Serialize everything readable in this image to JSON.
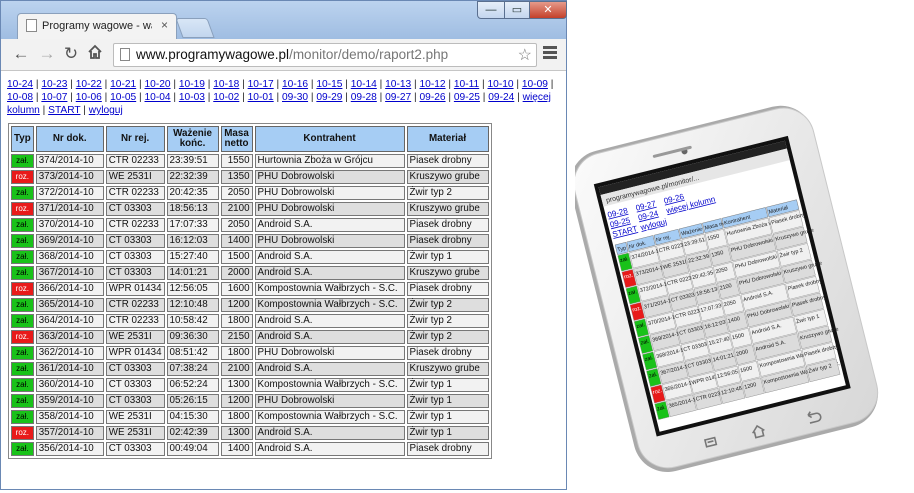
{
  "browser": {
    "tab_title": "Programy wagowe - waże",
    "tab_close": "×",
    "url_host": "www.programywagowe.pl",
    "url_path": "/monitor/demo/raport2.php",
    "buttons": {
      "minimize": "—",
      "maximize": "▭",
      "close": "✕"
    }
  },
  "nav": {
    "date_links": [
      "10-24",
      "10-23",
      "10-22",
      "10-21",
      "10-20",
      "10-19",
      "10-18",
      "10-17",
      "10-16",
      "10-15",
      "10-14",
      "10-13",
      "10-12",
      "10-11",
      "10-10",
      "10-09",
      "10-08",
      "10-07",
      "10-06",
      "10-05",
      "10-04",
      "10-03",
      "10-02",
      "10-01",
      "09-30",
      "09-29",
      "09-28",
      "09-27",
      "09-26",
      "09-25",
      "09-24"
    ],
    "more_columns": "więcej kolumn",
    "start": "START",
    "logout": "wyloguj"
  },
  "table": {
    "headers": [
      "Typ",
      "Nr dok.",
      "Nr rej.",
      "Ważenie końc.",
      "Masa netto",
      "Kontrahent",
      "Materiał"
    ],
    "rows": [
      {
        "type": "zał.",
        "doc": "374/2014-10",
        "reg": "CTR 02233",
        "time": "23:39:51",
        "mass": "1550",
        "contractor": "Hurtownia Zboża w Grójcu",
        "material": "Piasek drobny"
      },
      {
        "type": "roz.",
        "doc": "373/2014-10",
        "reg": "WE 2531I",
        "time": "22:32:39",
        "mass": "1350",
        "contractor": "PHU Dobrowolski",
        "material": "Kruszywo grube"
      },
      {
        "type": "zał.",
        "doc": "372/2014-10",
        "reg": "CTR 02233",
        "time": "20:42:35",
        "mass": "2050",
        "contractor": "PHU Dobrowolski",
        "material": "Żwir typ 2"
      },
      {
        "type": "roz.",
        "doc": "371/2014-10",
        "reg": "CT 03303",
        "time": "18:56:13",
        "mass": "2100",
        "contractor": "PHU Dobrowolski",
        "material": "Kruszywo grube"
      },
      {
        "type": "zał.",
        "doc": "370/2014-10",
        "reg": "CTR 02233",
        "time": "17:07:33",
        "mass": "2050",
        "contractor": "Android S.A.",
        "material": "Piasek drobny"
      },
      {
        "type": "zał.",
        "doc": "369/2014-10",
        "reg": "CT 03303",
        "time": "16:12:03",
        "mass": "1400",
        "contractor": "PHU Dobrowolski",
        "material": "Piasek drobny"
      },
      {
        "type": "zał.",
        "doc": "368/2014-10",
        "reg": "CT 03303",
        "time": "15:27:40",
        "mass": "1500",
        "contractor": "Android S.A.",
        "material": "Żwir typ 1"
      },
      {
        "type": "zał.",
        "doc": "367/2014-10",
        "reg": "CT 03303",
        "time": "14:01:21",
        "mass": "2000",
        "contractor": "Android S.A.",
        "material": "Kruszywo grube"
      },
      {
        "type": "roz.",
        "doc": "366/2014-10",
        "reg": "WPR 01434",
        "time": "12:56:05",
        "mass": "1600",
        "contractor": "Kompostownia Wałbrzych - S.C.",
        "material": "Piasek drobny"
      },
      {
        "type": "zał.",
        "doc": "365/2014-10",
        "reg": "CTR 02233",
        "time": "12:10:48",
        "mass": "1200",
        "contractor": "Kompostownia Wałbrzych - S.C.",
        "material": "Żwir typ 2"
      },
      {
        "type": "zał.",
        "doc": "364/2014-10",
        "reg": "CTR 02233",
        "time": "10:58:42",
        "mass": "1800",
        "contractor": "Android S.A.",
        "material": "Żwir typ 2"
      },
      {
        "type": "roz.",
        "doc": "363/2014-10",
        "reg": "WE 2531I",
        "time": "09:36:30",
        "mass": "2150",
        "contractor": "Android S.A.",
        "material": "Żwir typ 2"
      },
      {
        "type": "zał.",
        "doc": "362/2014-10",
        "reg": "WPR 01434",
        "time": "08:51:42",
        "mass": "1800",
        "contractor": "PHU Dobrowolski",
        "material": "Piasek drobny"
      },
      {
        "type": "zał.",
        "doc": "361/2014-10",
        "reg": "CT 03303",
        "time": "07:38:24",
        "mass": "2100",
        "contractor": "Android S.A.",
        "material": "Kruszywo grube"
      },
      {
        "type": "zał.",
        "doc": "360/2014-10",
        "reg": "CT 03303",
        "time": "06:52:24",
        "mass": "1300",
        "contractor": "Kompostownia Wałbrzych - S.C.",
        "material": "Żwir typ 1"
      },
      {
        "type": "zał.",
        "doc": "359/2014-10",
        "reg": "CT 03303",
        "time": "05:26:15",
        "mass": "1200",
        "contractor": "PHU Dobrowolski",
        "material": "Żwir typ 1"
      },
      {
        "type": "zał.",
        "doc": "358/2014-10",
        "reg": "WE 2531I",
        "time": "04:15:30",
        "mass": "1800",
        "contractor": "Kompostownia Wałbrzych - S.C.",
        "material": "Żwir typ 1"
      },
      {
        "type": "roz.",
        "doc": "357/2014-10",
        "reg": "WE 2531I",
        "time": "02:42:39",
        "mass": "1300",
        "contractor": "Android S.A.",
        "material": "Żwir typ 1"
      },
      {
        "type": "zał.",
        "doc": "356/2014-10",
        "reg": "CT 03303",
        "time": "00:49:04",
        "mass": "1400",
        "contractor": "Android S.A.",
        "material": "Piasek drobny"
      }
    ]
  },
  "phone": {
    "url": "programywagowe.pl/monitor/...",
    "links": [
      "09-28",
      "09-27",
      "09-26",
      "09-25",
      "09-24",
      "więcej kolumn",
      "START",
      "wyloguj"
    ],
    "headers": [
      "Typ",
      "Nr dok.",
      "Nr rej.",
      "Ważenie końc.",
      "Masa netto",
      "Kontrahent",
      "Materiał"
    ],
    "rows": [
      {
        "type": "zał.",
        "doc": "374/2014-10",
        "reg": "CTR 02233",
        "time": "23:39:51",
        "mass": "1550",
        "contractor": "Hurtownia Zboża w Grójcu",
        "material": "Piasek drobny"
      },
      {
        "type": "roz.",
        "doc": "373/2014-10",
        "reg": "WE 2531I",
        "time": "22:32:39",
        "mass": "1350",
        "contractor": "PHU Dobrowolski",
        "material": "Kruszywo grube"
      },
      {
        "type": "zał.",
        "doc": "372/2014-10",
        "reg": "CTR 02233",
        "time": "20:42:35",
        "mass": "2050",
        "contractor": "PHU Dobrowolski",
        "material": "Żwir typ 2"
      },
      {
        "type": "roz.",
        "doc": "371/2014-10",
        "reg": "CT 03303",
        "time": "18:56:13",
        "mass": "2100",
        "contractor": "PHU Dobrowolski",
        "material": "Kruszywo grube"
      },
      {
        "type": "zał.",
        "doc": "370/2014-10",
        "reg": "CTR 02233",
        "time": "17:07:33",
        "mass": "2050",
        "contractor": "Android S.A.",
        "material": "Piasek drobny"
      },
      {
        "type": "zał.",
        "doc": "369/2014-10",
        "reg": "CT 03303",
        "time": "16:12:03",
        "mass": "1400",
        "contractor": "PHU Dobrowolski",
        "material": "Piasek drobny"
      },
      {
        "type": "zał.",
        "doc": "368/2014-10",
        "reg": "CT 03303",
        "time": "15:27:40",
        "mass": "1500",
        "contractor": "Android S.A.",
        "material": "Żwir typ 1"
      },
      {
        "type": "zał.",
        "doc": "367/2014-10",
        "reg": "CT 03303",
        "time": "14:01:21",
        "mass": "2000",
        "contractor": "Android S.A.",
        "material": "Kruszywo grube"
      },
      {
        "type": "roz.",
        "doc": "366/2014-10",
        "reg": "WPR 01434",
        "time": "12:56:05",
        "mass": "1600",
        "contractor": "Kompostownia Wałbrzych - S.C.",
        "material": "Piasek drobny"
      },
      {
        "type": "zał.",
        "doc": "365/2014-10",
        "reg": "CTR 02233",
        "time": "12:10:48",
        "mass": "1200",
        "contractor": "Kompostownia Wałbrzych - S.C.",
        "material": "Żwir typ 2"
      }
    ]
  },
  "colors": {
    "zal": "#19c219",
    "roz": "#e81a1a",
    "header": "#a6cdf4",
    "link": "#0000cc"
  }
}
